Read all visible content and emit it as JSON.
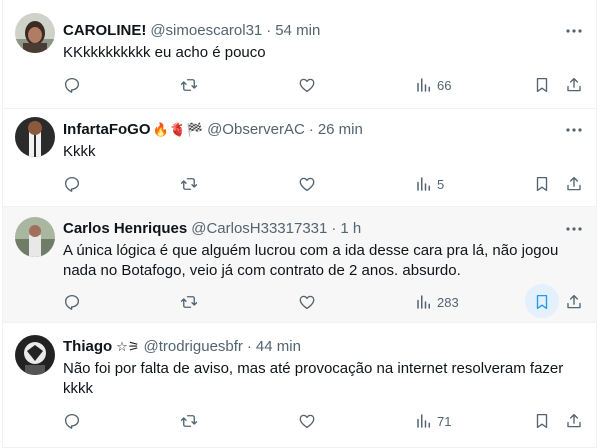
{
  "replies": [
    {
      "display_name": "CAROLINE!",
      "handle": "@simoescarol31",
      "separator": "·",
      "time": "54 min",
      "text": "KKkkkkkkkkk eu acho é pouco",
      "badges": [],
      "views": "66",
      "bookmarked": false
    },
    {
      "display_name": "InfartaFoGO",
      "handle": "@ObserverAC",
      "separator": "·",
      "time": "26 min",
      "text": "Kkkk",
      "badges": [
        "🔥",
        "🫀",
        "🏁"
      ],
      "views": "5",
      "bookmarked": false
    },
    {
      "display_name": "Carlos Henriques",
      "handle": "@CarlosH33317331",
      "separator": "·",
      "time": "1 h",
      "text": "A única lógica é que alguém lucrou com a ida desse cara pra lá, não jogou nada no Botafogo, veio já com contrato de 2 anos. absurdo.",
      "badges": [],
      "views": "283",
      "bookmarked": true
    },
    {
      "display_name": "Thiago",
      "handle": "@trodriguesbfr",
      "separator": "·",
      "time": "44 min",
      "text": "Não foi por falta de aviso, mas até provocação na  internet resolveram fazer kkkk",
      "badges": [
        "☆⚞"
      ],
      "views": "71",
      "bookmarked": false
    }
  ],
  "icons": {
    "reply": "reply-icon",
    "retweet": "retweet-icon",
    "like": "heart-icon",
    "views": "views-chart-icon",
    "bookmark": "bookmark-icon",
    "share": "share-icon",
    "more": "more-dots-icon"
  },
  "colors": {
    "text": "#0f1419",
    "secondary": "#536471",
    "accent": "#1d9bf0",
    "highlight_bg": "#f7f7f7"
  }
}
